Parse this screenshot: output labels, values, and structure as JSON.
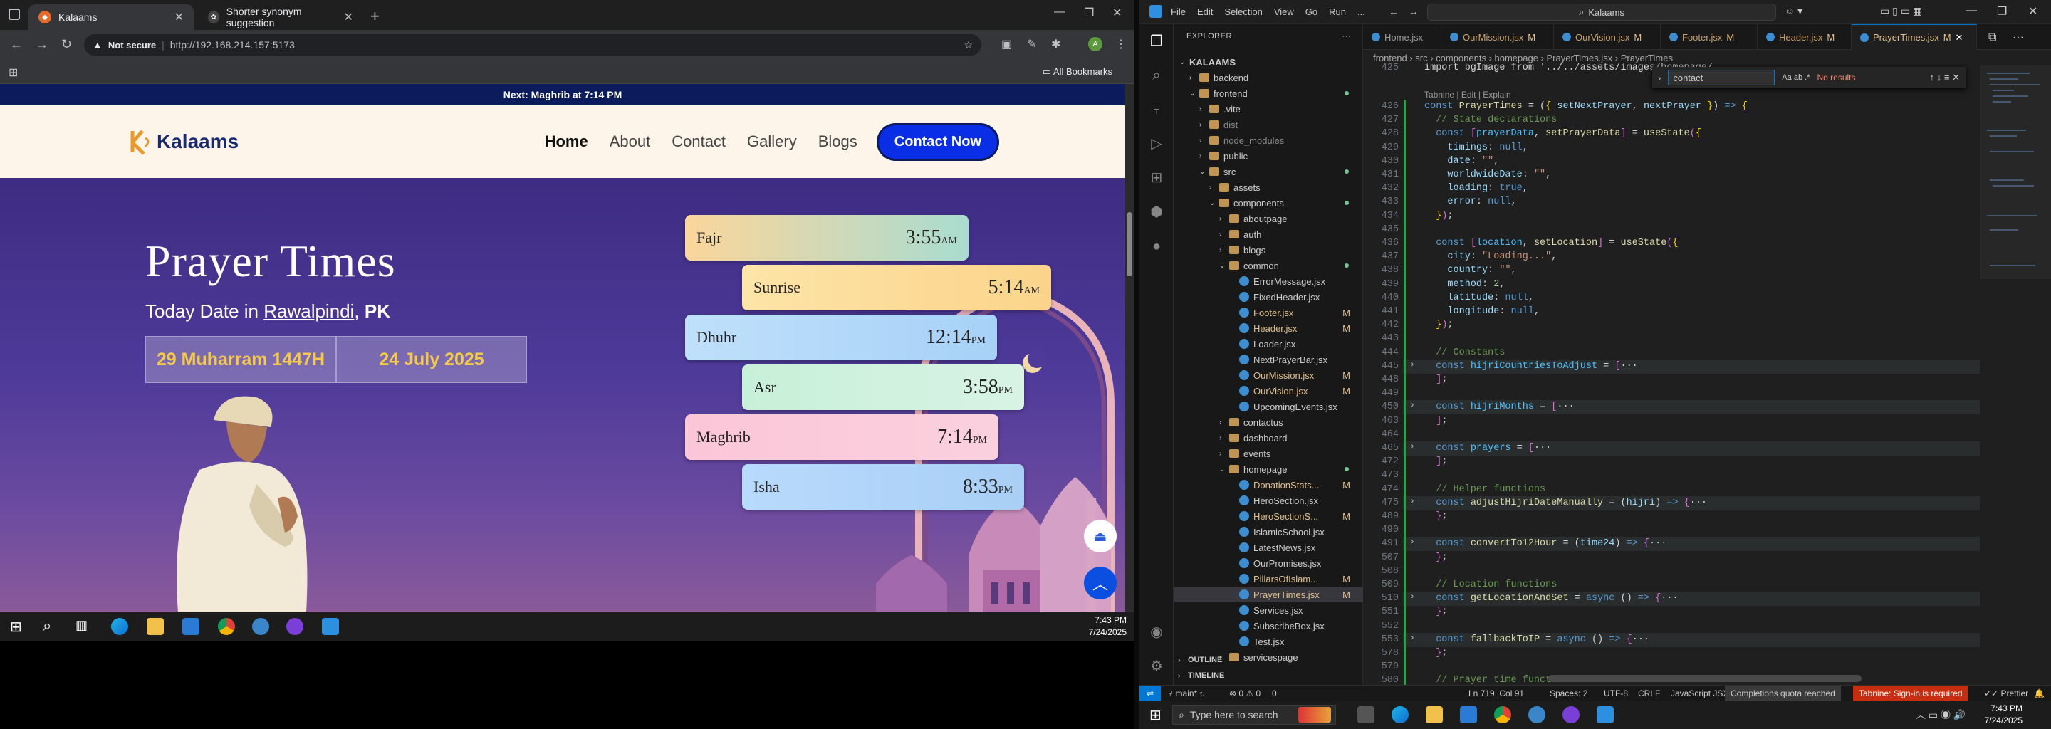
{
  "browser": {
    "tabs": [
      {
        "title": "Kalaams",
        "active": true
      },
      {
        "title": "Shorter synonym suggestion",
        "active": false
      }
    ],
    "security": "Not secure",
    "url": "http://192.168.214.157:5173",
    "bookmarks_label": "All Bookmarks"
  },
  "site": {
    "notice": "Next: Maghrib at 7:14 PM",
    "logo_text": "Kalaams",
    "nav": [
      {
        "label": "Home",
        "active": true
      },
      {
        "label": "About",
        "active": false
      },
      {
        "label": "Contact",
        "active": false
      },
      {
        "label": "Gallery",
        "active": false
      },
      {
        "label": "Blogs",
        "active": false
      }
    ],
    "cta": "Contact Now",
    "hero": {
      "title": "Prayer Times",
      "date_prefix": "Today Date in",
      "city": "Rawalpindi",
      "country": "PK",
      "hijri": "29 Muharram 1447H",
      "gregorian": "24 July 2025"
    },
    "prayers": [
      {
        "name": "Fajr",
        "time": "3:55",
        "ampm": "AM"
      },
      {
        "name": "Sunrise",
        "time": "5:14",
        "ampm": "AM"
      },
      {
        "name": "Dhuhr",
        "time": "12:14",
        "ampm": "PM"
      },
      {
        "name": "Asr",
        "time": "3:58",
        "ampm": "PM"
      },
      {
        "name": "Maghrib",
        "time": "7:14",
        "ampm": "PM"
      },
      {
        "name": "Isha",
        "time": "8:33",
        "ampm": "PM"
      }
    ]
  },
  "left_taskbar": {
    "time": "7:43 PM",
    "date": "7/24/2025"
  },
  "vscode": {
    "menu": [
      "File",
      "Edit",
      "Selection",
      "View",
      "Go",
      "Run",
      "..."
    ],
    "search": "Kalaams",
    "explorer_title": "EXPLORER",
    "tabs": [
      {
        "name": "Home.jsx",
        "mod": ""
      },
      {
        "name": "OurMission.jsx",
        "mod": "M"
      },
      {
        "name": "OurVision.jsx",
        "mod": "M"
      },
      {
        "name": "Footer.jsx",
        "mod": "M"
      },
      {
        "name": "Header.jsx",
        "mod": "M"
      },
      {
        "name": "PrayerTimes.jsx",
        "mod": "M"
      }
    ],
    "breadcrumb": "frontend › src › components › homepage › PrayerTimes.jsx › PrayerTimes",
    "find": {
      "value": "contact",
      "result": "No results"
    },
    "tree": [
      {
        "label": "KALAAMS",
        "depth": 0,
        "kind": "root"
      },
      {
        "label": "backend",
        "depth": 1,
        "kind": "folder"
      },
      {
        "label": "frontend",
        "depth": 1,
        "kind": "folder",
        "open": true,
        "dot": true
      },
      {
        "label": ".vite",
        "depth": 2,
        "kind": "folder"
      },
      {
        "label": "dist",
        "depth": 2,
        "kind": "folder",
        "dim": true
      },
      {
        "label": "node_modules",
        "depth": 2,
        "kind": "folder",
        "dim": true
      },
      {
        "label": "public",
        "depth": 2,
        "kind": "folder"
      },
      {
        "label": "src",
        "depth": 2,
        "kind": "folder",
        "open": true,
        "dot": true
      },
      {
        "label": "assets",
        "depth": 3,
        "kind": "folder"
      },
      {
        "label": "components",
        "depth": 3,
        "kind": "folder",
        "open": true,
        "dot": true
      },
      {
        "label": "aboutpage",
        "depth": 4,
        "kind": "folder"
      },
      {
        "label": "auth",
        "depth": 4,
        "kind": "folder"
      },
      {
        "label": "blogs",
        "depth": 4,
        "kind": "folder"
      },
      {
        "label": "common",
        "depth": 4,
        "kind": "folder",
        "open": true,
        "dot": true
      },
      {
        "label": "ErrorMessage.jsx",
        "depth": 5,
        "kind": "file"
      },
      {
        "label": "FixedHeader.jsx",
        "depth": 5,
        "kind": "file"
      },
      {
        "label": "Footer.jsx",
        "depth": 5,
        "kind": "file",
        "mod": "M"
      },
      {
        "label": "Header.jsx",
        "depth": 5,
        "kind": "file",
        "mod": "M"
      },
      {
        "label": "Loader.jsx",
        "depth": 5,
        "kind": "file"
      },
      {
        "label": "NextPrayerBar.jsx",
        "depth": 5,
        "kind": "file"
      },
      {
        "label": "OurMission.jsx",
        "depth": 5,
        "kind": "file",
        "mod": "M"
      },
      {
        "label": "OurVision.jsx",
        "depth": 5,
        "kind": "file",
        "mod": "M"
      },
      {
        "label": "UpcomingEvents.jsx",
        "depth": 5,
        "kind": "file"
      },
      {
        "label": "contactus",
        "depth": 4,
        "kind": "folder"
      },
      {
        "label": "dashboard",
        "depth": 4,
        "kind": "folder"
      },
      {
        "label": "events",
        "depth": 4,
        "kind": "folder"
      },
      {
        "label": "homepage",
        "depth": 4,
        "kind": "folder",
        "open": true,
        "dot": true
      },
      {
        "label": "DonationStats...",
        "depth": 5,
        "kind": "file",
        "mod": "M"
      },
      {
        "label": "HeroSection.jsx",
        "depth": 5,
        "kind": "file"
      },
      {
        "label": "HeroSectionS...",
        "depth": 5,
        "kind": "file",
        "mod": "M"
      },
      {
        "label": "IslamicSchool.jsx",
        "depth": 5,
        "kind": "file"
      },
      {
        "label": "LatestNews.jsx",
        "depth": 5,
        "kind": "file"
      },
      {
        "label": "OurPromises.jsx",
        "depth": 5,
        "kind": "file"
      },
      {
        "label": "PillarsOfIslam...",
        "depth": 5,
        "kind": "file",
        "mod": "M"
      },
      {
        "label": "PrayerTimes.jsx",
        "depth": 5,
        "kind": "file",
        "mod": "M",
        "selected": true
      },
      {
        "label": "Services.jsx",
        "depth": 5,
        "kind": "file"
      },
      {
        "label": "SubscribeBox.jsx",
        "depth": 5,
        "kind": "file"
      },
      {
        "label": "Test.jsx",
        "depth": 5,
        "kind": "file"
      },
      {
        "label": "servicespage",
        "depth": 4,
        "kind": "folder"
      }
    ],
    "outline": "OUTLINE",
    "timeline": "TIMELINE",
    "codelens": "Tabnine | Edit | Explain",
    "code_lines": [
      {
        "n": "425",
        "h": "<span class='o'>import bgImage from '../../assets/images/homepage/</span>"
      },
      {
        "n": "426",
        "h": "<span class='k'>const</span> <span class='f'>PrayerTimes</span> <span class='o'>= (</span><span class='y'>{</span> <span class='v'>setNextPrayer</span><span class='o'>,</span> <span class='v'>nextPrayer</span> <span class='y'>}</span><span class='o'>) </span><span class='k'>=&gt;</span> <span class='y'>{</span>"
      },
      {
        "n": "427",
        "h": "  <span class='c'>// State declarations</span>"
      },
      {
        "n": "428",
        "h": "  <span class='k'>const</span> <span class='p'>[</span><span class='b'>prayerData</span><span class='o'>, </span><span class='f'>setPrayerData</span><span class='p'>]</span> <span class='o'>= </span><span class='f'>useState</span><span class='p'>(</span><span class='y'>{</span>"
      },
      {
        "n": "429",
        "h": "    <span class='v'>timings</span><span class='o'>: </span><span class='k'>null</span><span class='o'>,</span>"
      },
      {
        "n": "430",
        "h": "    <span class='v'>date</span><span class='o'>: </span><span class='s'>\"\"</span><span class='o'>,</span>"
      },
      {
        "n": "431",
        "h": "    <span class='v'>worldwideDate</span><span class='o'>: </span><span class='s'>\"\"</span><span class='o'>,</span>"
      },
      {
        "n": "432",
        "h": "    <span class='v'>loading</span><span class='o'>: </span><span class='k'>true</span><span class='o'>,</span>"
      },
      {
        "n": "433",
        "h": "    <span class='v'>error</span><span class='o'>: </span><span class='k'>null</span><span class='o'>,</span>"
      },
      {
        "n": "434",
        "h": "  <span class='y'>}</span><span class='p'>)</span><span class='o'>;</span>"
      },
      {
        "n": "435",
        "h": ""
      },
      {
        "n": "436",
        "h": "  <span class='k'>const</span> <span class='p'>[</span><span class='b'>location</span><span class='o'>, </span><span class='f'>setLocation</span><span class='p'>]</span> <span class='o'>= </span><span class='f'>useState</span><span class='p'>(</span><span class='y'>{</span>"
      },
      {
        "n": "437",
        "h": "    <span class='v'>city</span><span class='o'>: </span><span class='s'>\"Loading...\"</span><span class='o'>,</span>"
      },
      {
        "n": "438",
        "h": "    <span class='v'>country</span><span class='o'>: </span><span class='s'>\"\"</span><span class='o'>,</span>"
      },
      {
        "n": "439",
        "h": "    <span class='v'>method</span><span class='o'>: </span><span class='n'>2</span><span class='o'>,</span>"
      },
      {
        "n": "440",
        "h": "    <span class='v'>latitude</span><span class='o'>: </span><span class='k'>null</span><span class='o'>,</span>"
      },
      {
        "n": "441",
        "h": "    <span class='v'>longitude</span><span class='o'>: </span><span class='k'>null</span><span class='o'>,</span>"
      },
      {
        "n": "442",
        "h": "  <span class='y'>}</span><span class='p'>)</span><span class='o'>;</span>"
      },
      {
        "n": "443",
        "h": ""
      },
      {
        "n": "444",
        "h": "  <span class='c'>// Constants</span>"
      },
      {
        "n": "445",
        "h": "  <span class='k'>const</span> <span class='b'>hijriCountriesToAdjust</span> <span class='o'>= </span><span class='p'>[</span><span class='o'>···</span>",
        "fold": true
      },
      {
        "n": "448",
        "h": "  <span class='p'>]</span><span class='o'>;</span>"
      },
      {
        "n": "449",
        "h": ""
      },
      {
        "n": "450",
        "h": "  <span class='k'>const</span> <span class='b'>hijriMonths</span> <span class='o'>= </span><span class='p'>[</span><span class='o'>···</span>",
        "fold": true
      },
      {
        "n": "463",
        "h": "  <span class='p'>]</span><span class='o'>;</span>"
      },
      {
        "n": "464",
        "h": ""
      },
      {
        "n": "465",
        "h": "  <span class='k'>const</span> <span class='b'>prayers</span> <span class='o'>= </span><span class='p'>[</span><span class='o'>···</span>",
        "fold": true
      },
      {
        "n": "472",
        "h": "  <span class='p'>]</span><span class='o'>;</span>"
      },
      {
        "n": "473",
        "h": ""
      },
      {
        "n": "474",
        "h": "  <span class='c'>// Helper functions</span>"
      },
      {
        "n": "475",
        "h": "  <span class='k'>const</span> <span class='f'>adjustHijriDateManually</span> <span class='o'>= (</span><span class='v'>hijri</span><span class='o'>) </span><span class='k'>=&gt;</span> <span class='p'>{</span><span class='o'>···</span>",
        "fold": true
      },
      {
        "n": "489",
        "h": "  <span class='p'>}</span><span class='o'>;</span>"
      },
      {
        "n": "490",
        "h": ""
      },
      {
        "n": "491",
        "h": "  <span class='k'>const</span> <span class='f'>convertTo12Hour</span> <span class='o'>= (</span><span class='v'>time24</span><span class='o'>) </span><span class='k'>=&gt;</span> <span class='p'>{</span><span class='o'>···</span>",
        "fold": true
      },
      {
        "n": "507",
        "h": "  <span class='p'>}</span><span class='o'>;</span>"
      },
      {
        "n": "508",
        "h": ""
      },
      {
        "n": "509",
        "h": "  <span class='c'>// Location functions</span>"
      },
      {
        "n": "510",
        "h": "  <span class='k'>const</span> <span class='f'>getLocationAndSet</span> <span class='o'>= </span><span class='k'>async</span> <span class='o'>() </span><span class='k'>=&gt;</span> <span class='p'>{</span><span class='o'>···</span>",
        "fold": true
      },
      {
        "n": "551",
        "h": "  <span class='p'>}</span><span class='o'>;</span>"
      },
      {
        "n": "552",
        "h": ""
      },
      {
        "n": "553",
        "h": "  <span class='k'>const</span> <span class='f'>fallbackToIP</span> <span class='o'>= </span><span class='k'>async</span> <span class='o'>() </span><span class='k'>=&gt;</span> <span class='p'>{</span><span class='o'>···</span>",
        "fold": true
      },
      {
        "n": "578",
        "h": "  <span class='p'>}</span><span class='o'>;</span>"
      },
      {
        "n": "579",
        "h": ""
      },
      {
        "n": "580",
        "h": "  <span class='c'>// Prayer time functions</span>"
      }
    ],
    "status": {
      "branch": "main*",
      "problems": "⊗ 0 ⚠ 0",
      "errors": "0",
      "position": "Ln 719, Col 91",
      "spaces": "Spaces: 2",
      "encoding": "UTF-8",
      "eol": "CRLF",
      "language": "JavaScript JSX",
      "quota": "Completions quota reached",
      "tabnine": "Tabnine: Sign-in is required",
      "prettier": "✓✓ Prettier"
    }
  },
  "right_taskbar": {
    "search_placeholder": "Type here to search",
    "time": "7:43 PM",
    "date": "7/24/2025"
  },
  "colors": {
    "accent_blue": "#0a2ee6",
    "gold": "#f6c94a",
    "vscode_blue": "#0078d4"
  }
}
